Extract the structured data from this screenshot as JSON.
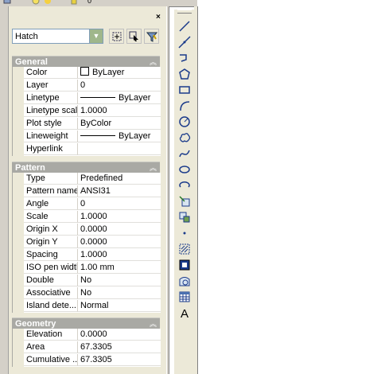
{
  "top_strip": {
    "counter": "0"
  },
  "palette": {
    "type_selector": "Hatch",
    "close_glyph": "×",
    "sections": [
      {
        "title": "General",
        "rows": [
          {
            "key": "Color",
            "value": "ByLayer",
            "swatch": true
          },
          {
            "key": "Layer",
            "value": "0"
          },
          {
            "key": "Linetype",
            "value": "ByLayer",
            "line": true
          },
          {
            "key": "Linetype scale",
            "value": "1.0000"
          },
          {
            "key": "Plot style",
            "value": "ByColor"
          },
          {
            "key": "Lineweight",
            "value": "ByLayer",
            "line": true
          },
          {
            "key": "Hyperlink",
            "value": ""
          }
        ]
      },
      {
        "title": "Pattern",
        "rows": [
          {
            "key": "Type",
            "value": "Predefined"
          },
          {
            "key": "Pattern name",
            "value": "ANSI31"
          },
          {
            "key": "Angle",
            "value": "0"
          },
          {
            "key": "Scale",
            "value": "1.0000"
          },
          {
            "key": "Origin X",
            "value": "0.0000"
          },
          {
            "key": "Origin Y",
            "value": "0.0000"
          },
          {
            "key": "Spacing",
            "value": "1.0000"
          },
          {
            "key": "ISO pen width",
            "value": "1.00 mm"
          },
          {
            "key": "Double",
            "value": "No"
          },
          {
            "key": "Associative",
            "value": "No"
          },
          {
            "key": "Island dete...",
            "value": "Normal"
          }
        ]
      },
      {
        "title": "Geometry",
        "rows": [
          {
            "key": "Elevation",
            "value": "0.0000"
          },
          {
            "key": "Area",
            "value": "67.3305"
          },
          {
            "key": "Cumulative ...",
            "value": "67.3305"
          }
        ]
      }
    ]
  },
  "draw_toolbar": {
    "tools": [
      "line-icon",
      "construction-line-icon",
      "polyline-icon",
      "polygon-icon",
      "rectangle-icon",
      "arc-icon",
      "circle-icon",
      "revision-cloud-icon",
      "spline-icon",
      "ellipse-icon",
      "ellipse-arc-icon",
      "insert-block-icon",
      "make-block-icon",
      "point-icon",
      "hatch-icon",
      "gradient-icon",
      "region-icon",
      "table-icon",
      "multiline-text-icon"
    ],
    "text_tool_label": "A"
  }
}
